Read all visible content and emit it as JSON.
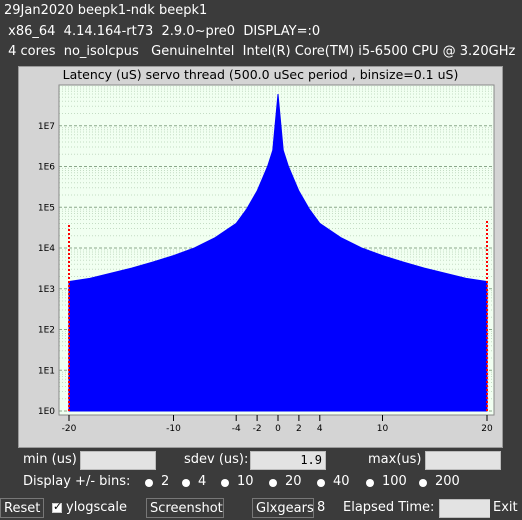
{
  "header": {
    "line1": "29Jan2020 beepk1-ndk beepk1",
    "line2": " x86_64  4.14.164-rt73  2.9.0~pre0  DISPLAY=:0",
    "line3": " 4 cores  no_isolcpus   GenuineIntel  Intel(R) Core(TM) i5-6500 CPU @ 3.20GHz"
  },
  "chart_data": {
    "type": "area",
    "title": "Latency (uS) servo thread (500.0 uSec period , binsize=0.1 uS)",
    "xlabel": "",
    "ylabel": "",
    "yscale": "log",
    "ylim": [
      1,
      100000000
    ],
    "xlim": [
      -20,
      20
    ],
    "x_ticks": [
      "-20",
      "-10",
      "-4",
      "-2",
      "0",
      "2",
      "4",
      "10",
      "20"
    ],
    "y_ticks": [
      "1E0",
      "1E1",
      "1E2",
      "1E3",
      "1E4",
      "1E5",
      "1E6",
      "1E7"
    ],
    "grid": true,
    "series": [
      {
        "color": "#0000ff",
        "points": [
          [
            -20,
            1500
          ],
          [
            -18,
            1800
          ],
          [
            -16,
            2400
          ],
          [
            -14,
            3200
          ],
          [
            -12,
            4500
          ],
          [
            -10,
            6500
          ],
          [
            -8,
            10000
          ],
          [
            -6,
            18000
          ],
          [
            -4,
            40000
          ],
          [
            -3,
            90000
          ],
          [
            -2,
            250000
          ],
          [
            -1.5,
            500000
          ],
          [
            -1,
            1000000
          ],
          [
            -0.5,
            2500000
          ],
          [
            0,
            60000000
          ],
          [
            0.5,
            2500000
          ],
          [
            1,
            1000000
          ],
          [
            1.5,
            500000
          ],
          [
            2,
            250000
          ],
          [
            3,
            90000
          ],
          [
            4,
            40000
          ],
          [
            6,
            18000
          ],
          [
            8,
            10000
          ],
          [
            10,
            6500
          ],
          [
            12,
            4500
          ],
          [
            14,
            3200
          ],
          [
            16,
            2400
          ],
          [
            18,
            1800
          ],
          [
            20,
            1500
          ]
        ]
      }
    ],
    "markers": [
      {
        "x": -20,
        "y": 40000,
        "color": "#ff0000"
      },
      {
        "x": 20,
        "y": 50000,
        "color": "#ff0000"
      }
    ]
  },
  "controls": {
    "min_label": "min (us)",
    "min_value": "",
    "sdev_label": "sdev (us):",
    "sdev_value": "1.9",
    "max_label": "max(us)",
    "max_value": "",
    "bins_label": "Display +/- bins:",
    "bins": [
      "2",
      "4",
      "10",
      "20",
      "40",
      "100",
      "200"
    ]
  },
  "buttons": {
    "reset": "Reset",
    "ylogscale": "ylogscale",
    "screenshot": "Screenshot",
    "glxgears": "Glxgears",
    "glxgears_count": "8",
    "elapsed_label": "Elapsed Time:",
    "elapsed_value": "",
    "exit": "Exit"
  }
}
